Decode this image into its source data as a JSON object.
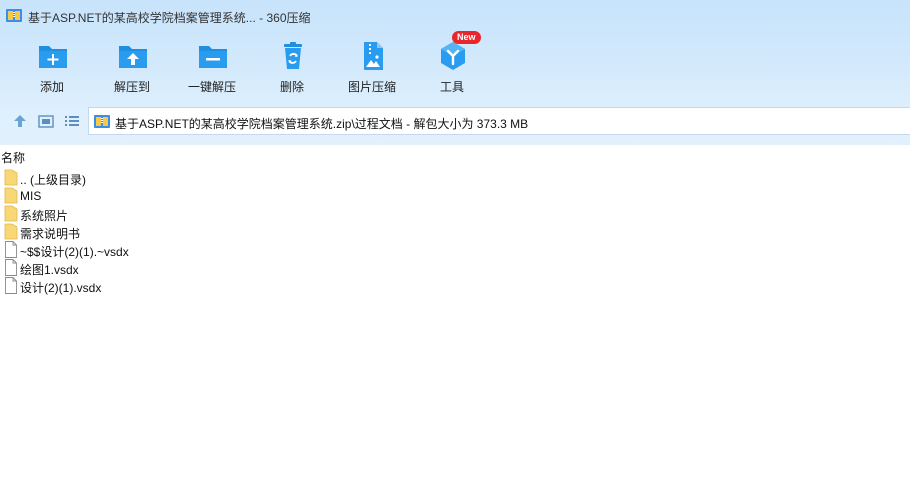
{
  "window": {
    "title": "基于ASP.NET的某高校学院档案管理系统... - 360压缩",
    "app_icon": "archive-icon"
  },
  "toolbar": {
    "items": [
      {
        "label": "添加",
        "icon": "folder-add-icon"
      },
      {
        "label": "解压到",
        "icon": "folder-extract-icon"
      },
      {
        "label": "一键解压",
        "icon": "folder-oneclick-icon"
      },
      {
        "label": "删除",
        "icon": "recycle-bin-icon"
      },
      {
        "label": "图片压缩",
        "icon": "image-compress-icon"
      },
      {
        "label": "工具",
        "icon": "tools-icon"
      }
    ],
    "tools_badge": "New"
  },
  "navigation": {
    "up_icon": "arrow-up-icon",
    "view_thumbnail_icon": "thumbnail-view-icon",
    "view_list_icon": "list-view-icon",
    "address": "基于ASP.NET的某高校学院档案管理系统.zip\\过程文档 - 解包大小为 373.3 MB"
  },
  "list": {
    "column_name": "名称",
    "items": [
      {
        "name": ".. (上级目录)",
        "type": "folder"
      },
      {
        "name": "MIS",
        "type": "folder"
      },
      {
        "name": "系统照片",
        "type": "folder"
      },
      {
        "name": "需求说明书",
        "type": "folder"
      },
      {
        "name": "~$$设计(2)(1).~vsdx",
        "type": "file"
      },
      {
        "name": "绘图1.vsdx",
        "type": "file"
      },
      {
        "name": "设计(2)(1).vsdx",
        "type": "file"
      }
    ]
  },
  "colors": {
    "accent_blue": "#1e8fe1",
    "badge_red": "#e8262b",
    "folder_yellow": "#f8d775",
    "toolbar_bg": "#d4eafc"
  }
}
